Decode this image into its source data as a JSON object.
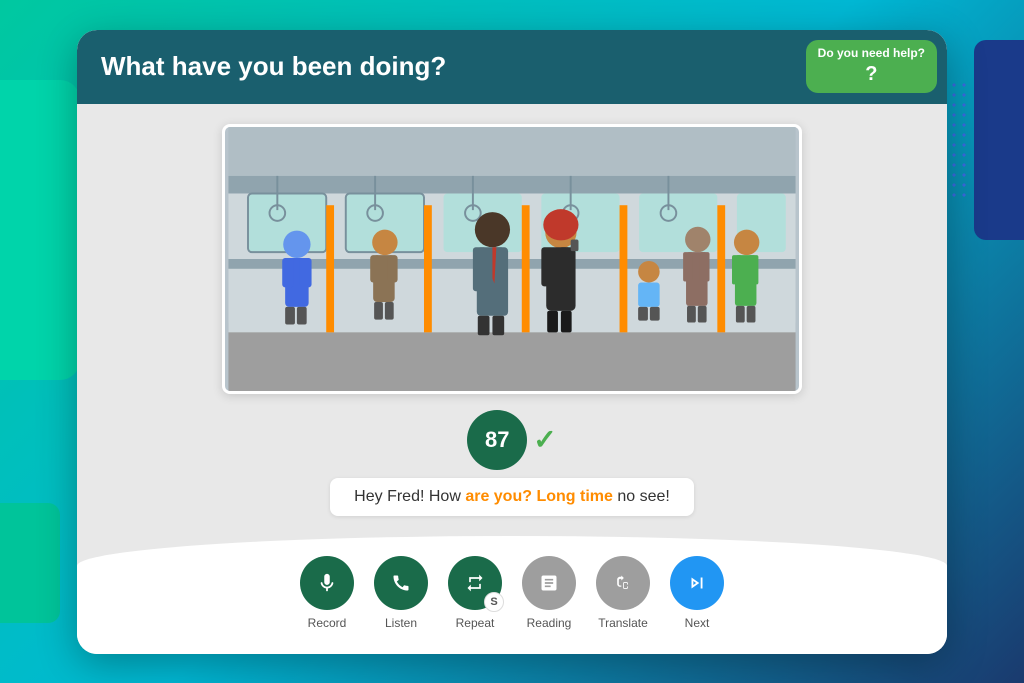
{
  "background": {
    "color_left": "#00d4aa",
    "color_right": "#1a3a8a"
  },
  "header": {
    "title": "What have you been doing?",
    "icon1_label": "video-icon",
    "icon2_label": "phone-icon",
    "help_text": "Do you need help?",
    "help_symbol": "?"
  },
  "score": {
    "value": "87",
    "checkmark": "✓"
  },
  "sentence": {
    "prefix": "Hey Fred! How ",
    "highlight": "are you? Long time",
    "suffix": " no see!"
  },
  "buttons": [
    {
      "id": "record",
      "label": "Record",
      "icon": "mic",
      "style": "dark-green"
    },
    {
      "id": "listen",
      "label": "Listen",
      "icon": "phone",
      "style": "dark-green"
    },
    {
      "id": "repeat",
      "label": "Repeat",
      "icon": "repeat",
      "style": "dark-green",
      "badge": "S"
    },
    {
      "id": "reading",
      "label": "Reading",
      "icon": "book",
      "style": "gray"
    },
    {
      "id": "translate",
      "label": "Translate",
      "icon": "crop",
      "style": "gray"
    },
    {
      "id": "next",
      "label": "Next",
      "icon": "next",
      "style": "blue"
    }
  ]
}
